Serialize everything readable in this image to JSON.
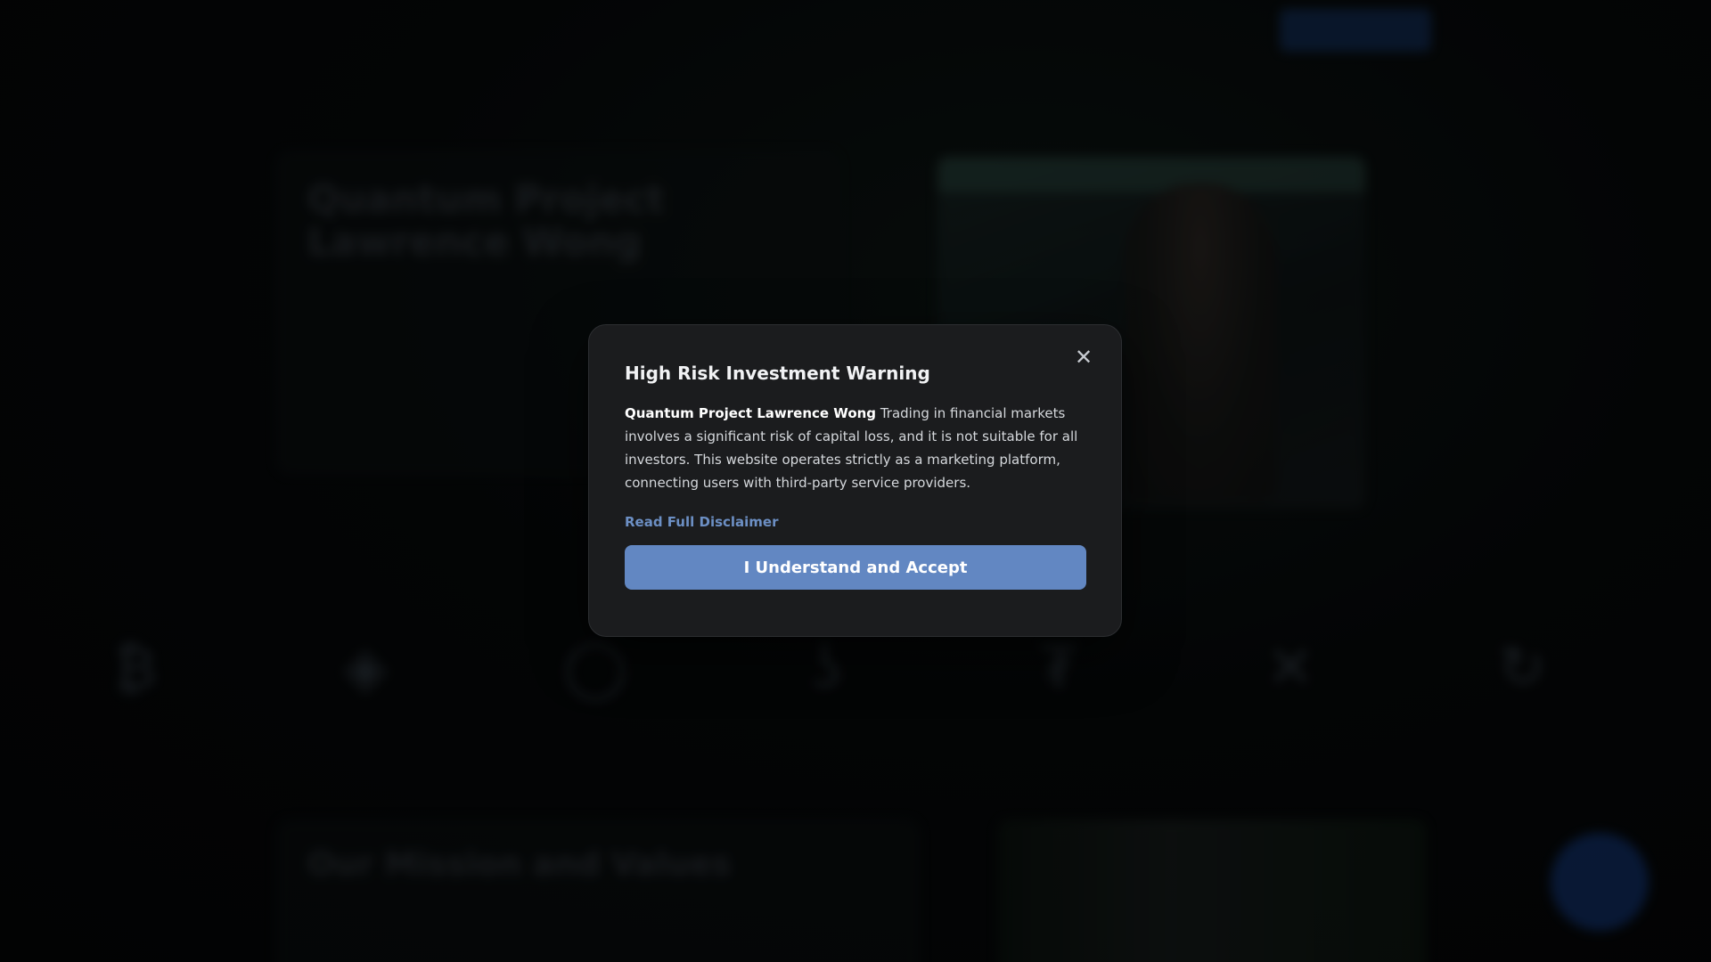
{
  "background": {
    "logo_text": "",
    "nav_items": [
      "",
      "",
      ""
    ],
    "cta_label": "",
    "hero": {
      "title": "Quantum Project Lawrence Wong",
      "text": ""
    },
    "coins": [
      {
        "icon": "bitcoin-icon",
        "glyph": "₿"
      },
      {
        "icon": "binance-icon",
        "glyph": "◈"
      },
      {
        "icon": "circle-coin-icon",
        "glyph": "◯"
      },
      {
        "icon": "coin-icon",
        "glyph": "ʖ"
      },
      {
        "icon": "tether-icon",
        "glyph": "₮"
      },
      {
        "icon": "xrp-icon",
        "glyph": "✕"
      },
      {
        "icon": "recycle-coin-icon",
        "glyph": "↻"
      }
    ],
    "mission": {
      "title": "Our Mission and Values",
      "text": ""
    }
  },
  "modal": {
    "title": "High Risk Investment Warning",
    "brand": "Quantum Project Lawrence Wong",
    "body": " Trading in financial markets involves a significant risk of capital loss, and it is not suitable for all investors. This website operates strictly as a marketing platform, connecting users with third-party service providers.",
    "link_label": "Read Full Disclaimer",
    "accept_label": "I Understand and Accept",
    "close_glyph": "✕"
  },
  "colors": {
    "accent": "#6287c2",
    "link": "#6c8fc4",
    "modal_bg": "#1b1c1e"
  }
}
